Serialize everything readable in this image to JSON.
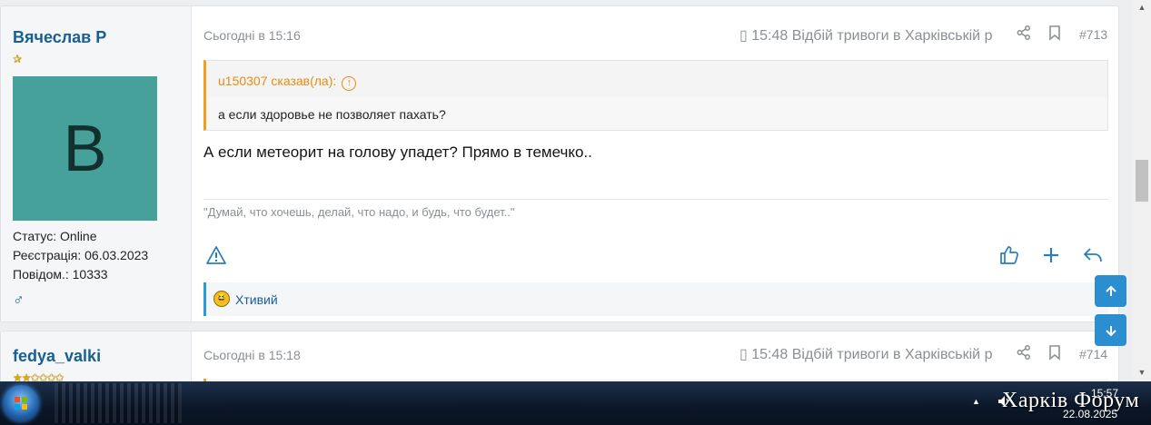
{
  "posts": [
    {
      "username": "Вячеслав Р",
      "stars": "✰",
      "avatar_letter": "В",
      "status": "Статус: Online",
      "registered": "Реєстрація: 06.03.2023",
      "messages": "Повідом.: 10333",
      "gender_icon": "♂",
      "date": "Сьогодні в 15:16",
      "top_link": "▯ 15:48 Відбій тривоги в Харківській р",
      "number": "#713",
      "quote": {
        "author": "u150307 сказав(ла):",
        "text": "а если здоровье не позволяет пахать?"
      },
      "body": "А если метеорит на голову упадет? Прямо в темечко..",
      "signature": "\"Думай, что хочешь, делай, что надо, и будь, что будет..\"",
      "reaction_user": "Хтивий"
    },
    {
      "username": "fedya_valki",
      "stars": "★★✩✩✩✩",
      "date": "Сьогодні в 15:18",
      "top_link": "▯ 15:48 Відбій тривоги в Харківській р",
      "number": "#714"
    }
  ],
  "taskbar": {
    "watermark": "Харків Форум",
    "time": "15:57",
    "date": "22.08.2025",
    "tray_up": "▲"
  },
  "colors": {
    "accent": "#176093",
    "quote_border": "#f0a020",
    "reaction_border": "#2a9bd6",
    "avatar_bg": "#46a19b",
    "nav_button": "#2b8ed0"
  },
  "icons": {
    "share": "share-icon",
    "bookmark": "bookmark-icon",
    "report": "warning-icon",
    "like": "thumbs-up-icon",
    "add": "plus-icon",
    "reply": "reply-icon",
    "scroll_up": "arrow-up-icon",
    "scroll_down": "arrow-down-icon"
  }
}
